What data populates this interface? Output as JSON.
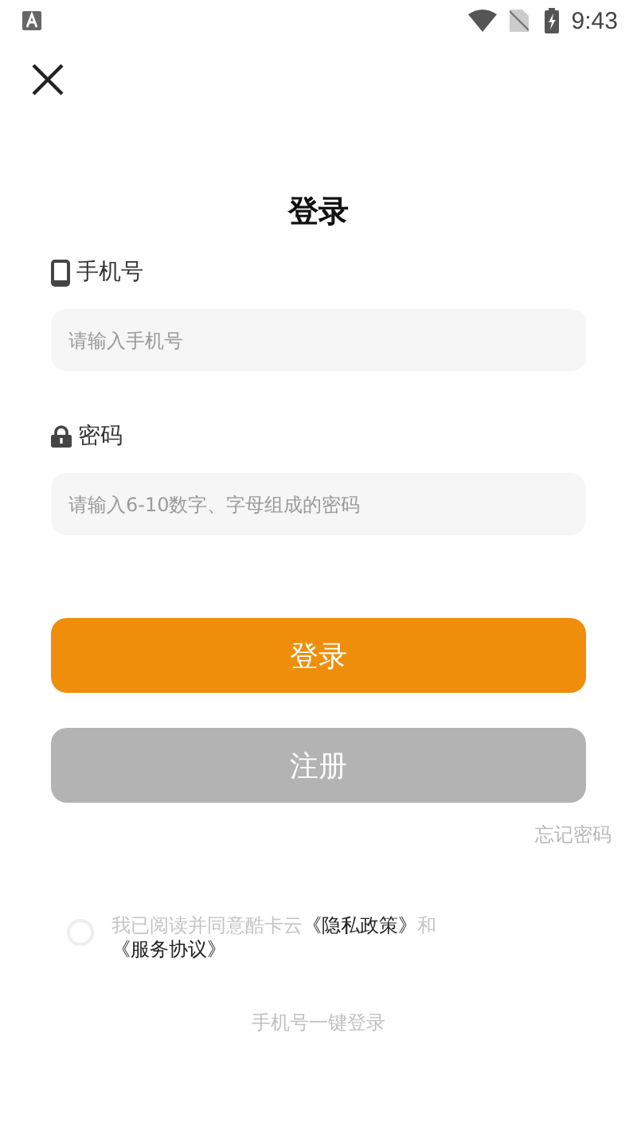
{
  "status_bar": {
    "time": "9:43"
  },
  "title": "登录",
  "fields": [
    {
      "kind": "phone",
      "label": "手机号",
      "placeholder": "请输入手机号"
    },
    {
      "kind": "password",
      "label": "密码",
      "placeholder": "请输入6-10数字、字母组成的密码"
    }
  ],
  "buttons": [
    {
      "kind": "primary",
      "label": "登录"
    },
    {
      "kind": "secondary",
      "label": "注册"
    }
  ],
  "forgot_password": "忘记密码",
  "agreement": {
    "checked": false,
    "parts": [
      {
        "kind": "text",
        "text": "我已阅读并同意酷卡云"
      },
      {
        "kind": "link",
        "text": "《隐私政策》"
      },
      {
        "kind": "text",
        "text": "和"
      },
      {
        "kind": "link",
        "text": "《服务协议》"
      }
    ]
  },
  "one_key_login": "手机号一键登录"
}
